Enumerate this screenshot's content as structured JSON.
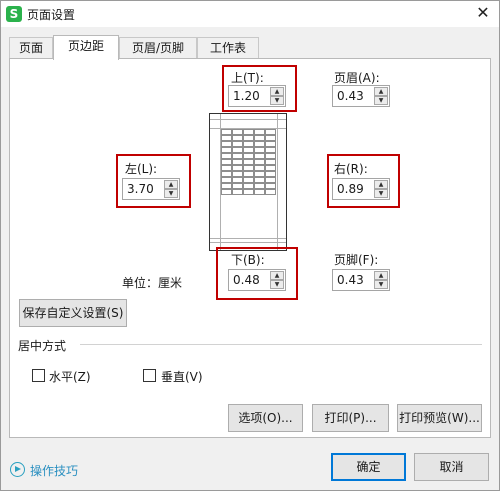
{
  "window": {
    "title": "页面设置",
    "app_icon_glyph": "S",
    "close_glyph": "✕"
  },
  "tabs": [
    "页面",
    "页边距",
    "页眉/页脚",
    "工作表"
  ],
  "active_tab": "页边距",
  "margins": {
    "top": {
      "label": "上(T):",
      "value": "1.20"
    },
    "header": {
      "label": "页眉(A):",
      "value": "0.43"
    },
    "left": {
      "label": "左(L):",
      "value": "3.70"
    },
    "right": {
      "label": "右(R):",
      "value": "0.89"
    },
    "bottom": {
      "label": "下(B):",
      "value": "0.48"
    },
    "footer": {
      "label": "页脚(F):",
      "value": "0.43"
    }
  },
  "unit_label": "单位：厘米",
  "save_custom_label": "保存自定义设置(S)",
  "centering": {
    "title": "居中方式",
    "horizontal_label": "水平(Z)",
    "horizontal_checked": false,
    "vertical_label": "垂直(V)",
    "vertical_checked": false
  },
  "buttons": {
    "options": "选项(O)...",
    "print": "打印(P)...",
    "print_preview": "打印预览(W)...",
    "ok": "确定",
    "cancel": "取消"
  },
  "help_link": "操作技巧",
  "colors": {
    "highlight": "#c00000",
    "accent": "#0078d7",
    "link": "#2a8fc0",
    "app_icon": "#2bb24c"
  },
  "icons": {
    "app": "wps-spreadsheet-icon",
    "close": "close-icon",
    "spinner_up": "arrow-up-icon",
    "spinner_down": "arrow-down-icon",
    "help": "play-circle-icon"
  }
}
